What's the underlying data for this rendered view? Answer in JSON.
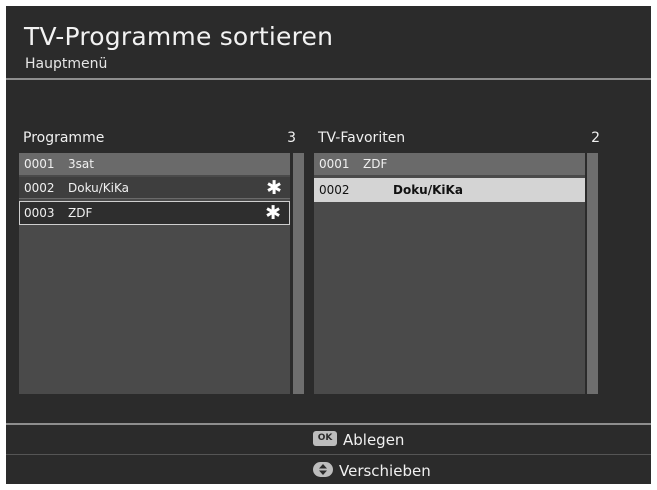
{
  "header": {
    "title": "TV-Programme sortieren",
    "subtitle": "Hauptmenü"
  },
  "left_list": {
    "title": "Programme",
    "count": "3",
    "rows": [
      {
        "num": "0001",
        "name": "3sat",
        "marked": false
      },
      {
        "num": "0002",
        "name": "Doku/KiKa",
        "marked": true
      },
      {
        "num": "0003",
        "name": "ZDF",
        "marked": true
      }
    ],
    "mark_glyph": "✱"
  },
  "right_list": {
    "title": "TV-Favoriten",
    "count": "2",
    "rows": [
      {
        "num": "0001",
        "name": "ZDF"
      },
      {
        "num": "0002",
        "name": "Doku/KiKa"
      }
    ]
  },
  "footer": {
    "ok_key": "OK",
    "ok_label": "Ablegen",
    "move_label": "Verschieben"
  },
  "icons": {
    "ok_key": "ok-button-icon",
    "move_key": "up-down-arrows-icon",
    "mark": "asterisk-icon"
  },
  "colors": {
    "background": "#2b2b2b",
    "list_background": "#4a4a4a",
    "selected_row": "#d4d4d4",
    "text": "#f0f0f0"
  }
}
